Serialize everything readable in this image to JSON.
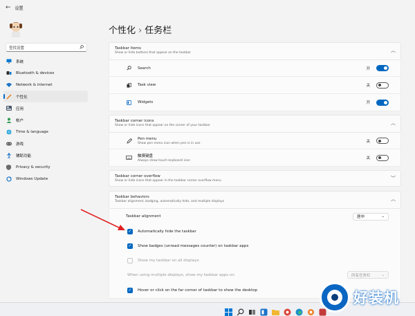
{
  "window": {
    "back_glyph": "←",
    "title": "设置"
  },
  "sidebar": {
    "search_placeholder": "查找设置",
    "search_icon": "search-icon",
    "items": [
      {
        "label": "系统",
        "icon": "monitor-icon",
        "active": false
      },
      {
        "label": "Bluetooth & devices",
        "icon": "bluetooth-icon",
        "active": false
      },
      {
        "label": "Network & internet",
        "icon": "wifi-icon",
        "active": false
      },
      {
        "label": "个性化",
        "icon": "brush-icon",
        "active": true
      },
      {
        "label": "应用",
        "icon": "apps-icon",
        "active": false
      },
      {
        "label": "帐户",
        "icon": "person-icon",
        "active": false
      },
      {
        "label": "Time & language",
        "icon": "globe-icon",
        "active": false
      },
      {
        "label": "游戏",
        "icon": "gamepad-icon",
        "active": false
      },
      {
        "label": "辅助功能",
        "icon": "accessibility-icon",
        "active": false
      },
      {
        "label": "Privacy & security",
        "icon": "shield-icon",
        "active": false
      },
      {
        "label": "Windows Update",
        "icon": "update-icon",
        "active": false
      }
    ]
  },
  "breadcrumb": {
    "parent": "个性化",
    "separator": "›",
    "current": "任务栏"
  },
  "taskbar_items": {
    "title": "Taskbar items",
    "subtitle": "Show or hide buttons that appear on the taskbar",
    "rows": [
      {
        "label": "Search",
        "state": "开",
        "on": true,
        "icon": "search-icon"
      },
      {
        "label": "Task view",
        "state": "关",
        "on": false,
        "icon": "task-view-icon"
      },
      {
        "label": "Widgets",
        "state": "开",
        "on": true,
        "icon": "widgets-icon"
      }
    ]
  },
  "corner_icons": {
    "title": "Taskbar corner icons",
    "subtitle": "Show or hide icons that appear on the corner of your taskbar",
    "rows": [
      {
        "label": "Pen menu",
        "sublabel": "Show pen menu icon when pen is in use",
        "state": "关",
        "on": false,
        "icon": "pen-icon"
      },
      {
        "label": "触摸键盘",
        "sublabel": "Always show touch keyboard icon",
        "state": "关",
        "on": false,
        "icon": "keyboard-icon"
      }
    ]
  },
  "corner_overflow": {
    "title": "Taskbar corner overflow",
    "subtitle": "Show or hide icons that appear in the taskbar corner overflow menu"
  },
  "behaviors": {
    "title": "Taskbar behaviors",
    "subtitle": "Taskbar alignment, badging, automatically hide, and multiple displays",
    "alignment_label": "Taskbar alignment",
    "alignment_value": "居中",
    "options": [
      {
        "label": "Automatically hide the taskbar",
        "checked": true,
        "disabled": false
      },
      {
        "label": "Show badges (unread messages counter) on taskbar apps",
        "checked": true,
        "disabled": false
      },
      {
        "label": "Show my taskbar on all displays",
        "checked": false,
        "disabled": true
      }
    ],
    "multi_display_label": "When using multiple displays, show my taskbar apps on",
    "multi_display_value": "所有任务栏",
    "hover_option": {
      "label": "Hover or click on the far corner of taskbar to show the desktop",
      "checked": true
    }
  },
  "watermark": {
    "text": "好装机"
  },
  "colors": {
    "accent": "#0067c0",
    "annotation_arrow": "#e02020"
  }
}
